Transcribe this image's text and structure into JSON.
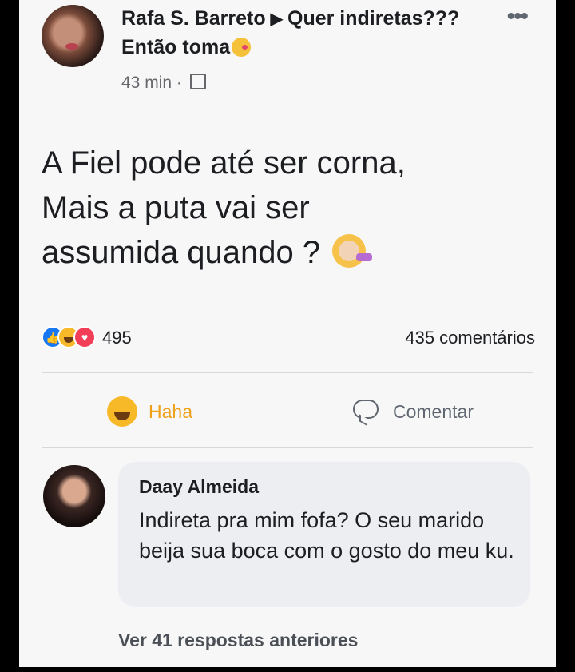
{
  "post": {
    "author": "Rafa S. Barreto",
    "group": "Quer indiretas??? Então toma",
    "time": "43 min",
    "text_lines": [
      "A Fiel pode até ser corna,",
      "Mais a puta vai ser",
      "assumida quando ?"
    ],
    "reaction_count": "495",
    "comments_count": "435 comentários",
    "reactions": [
      "like-icon",
      "haha-icon",
      "love-icon"
    ]
  },
  "actions": {
    "haha_label": "Haha",
    "comment_label": "Comentar",
    "haha_color": "#f0a11a"
  },
  "comment": {
    "author": "Daay Almeida",
    "text": "Indireta pra mim fofa? O seu marido beija sua boca com o gosto do meu ku."
  },
  "replies": {
    "label": "Ver 41 respostas anteriores"
  }
}
